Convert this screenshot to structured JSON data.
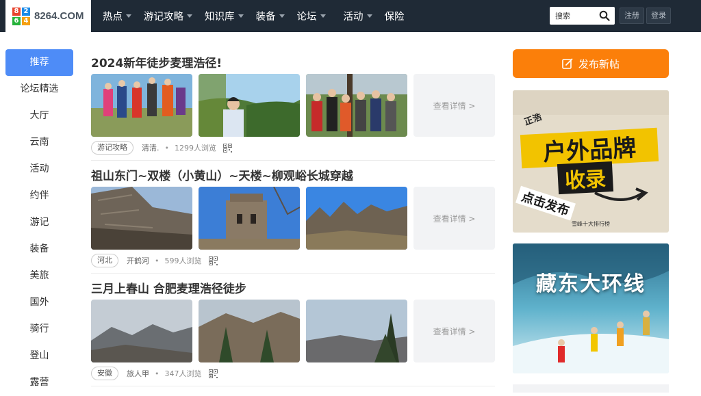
{
  "site": {
    "logo_digits": [
      "8",
      "2",
      "6",
      "4"
    ],
    "name": "8264.COM"
  },
  "nav": {
    "items": [
      {
        "label": "热点",
        "has_dropdown": true
      },
      {
        "label": "游记攻略",
        "has_dropdown": true
      },
      {
        "label": "知识库",
        "has_dropdown": true
      },
      {
        "label": "装备",
        "has_dropdown": true
      },
      {
        "label": "论坛",
        "has_dropdown": true
      },
      {
        "label": "活动",
        "has_dropdown": true
      },
      {
        "label": "保险",
        "has_dropdown": false
      }
    ],
    "search_placeholder": "搜索",
    "register": "注册",
    "login": "登录"
  },
  "sidebar": {
    "items": [
      "推荐",
      "论坛精选",
      "大厅",
      "云南",
      "活动",
      "约伴",
      "游记",
      "装备",
      "美旅",
      "国外",
      "骑行",
      "登山",
      "露营"
    ],
    "active_index": 0
  },
  "posts": [
    {
      "title": "2024新年徒步麦理浩径!",
      "tag": "游记攻略",
      "author": "清清.",
      "views": "1299人浏览",
      "more": "查看详情 >"
    },
    {
      "title": "祖山东门~双楼（小黄山）~天楼~柳观峪长城穿越",
      "tag": "河北",
      "author": "开鹤河",
      "views": "599人浏览",
      "more": "查看详情 >"
    },
    {
      "title": "三月上春山 合肥麦理浩径徒步",
      "tag": "安徽",
      "author": "旅人甲",
      "views": "347人浏览",
      "more": "查看详情 >"
    }
  ],
  "sidebar_right": {
    "publish_label": "发布新帖",
    "banner1": {
      "line1": "户外品牌",
      "line2": "收录",
      "sub": "点击发布",
      "corner": "正浩",
      "footer": "雪峰十大排行榜"
    },
    "banner2": {
      "title": "藏东大环线"
    }
  },
  "colors": {
    "topbar": "#1f2a36",
    "active_side": "#4e8cf7",
    "publish": "#fb7f0a"
  }
}
